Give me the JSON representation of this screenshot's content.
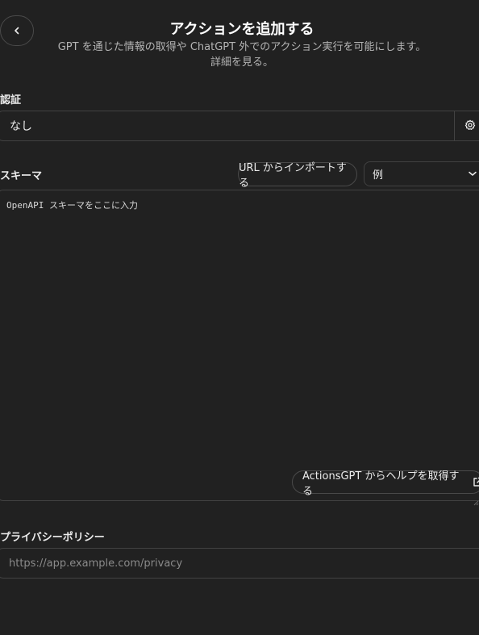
{
  "header": {
    "title": "アクションを追加する",
    "subtitle_line1": "GPT を通じた情報の取得や ChatGPT 外でのアクション実行を可能にします。",
    "subtitle_line2": "詳細を見る。"
  },
  "auth": {
    "label": "認証",
    "value": "なし",
    "settings_icon": "gear-icon"
  },
  "schema": {
    "label": "スキーマ",
    "import_button": "URL からインポートする",
    "example_select": "例",
    "placeholder": "OpenAPI スキーマをここに入力",
    "help_button": "ActionsGPT からヘルプを取得する"
  },
  "privacy": {
    "label": "プライバシーポリシー",
    "placeholder": "https://app.example.com/privacy"
  },
  "colors": {
    "background": "#212121",
    "border": "#424242",
    "text": "#ececec",
    "muted": "#b4b4b4"
  }
}
